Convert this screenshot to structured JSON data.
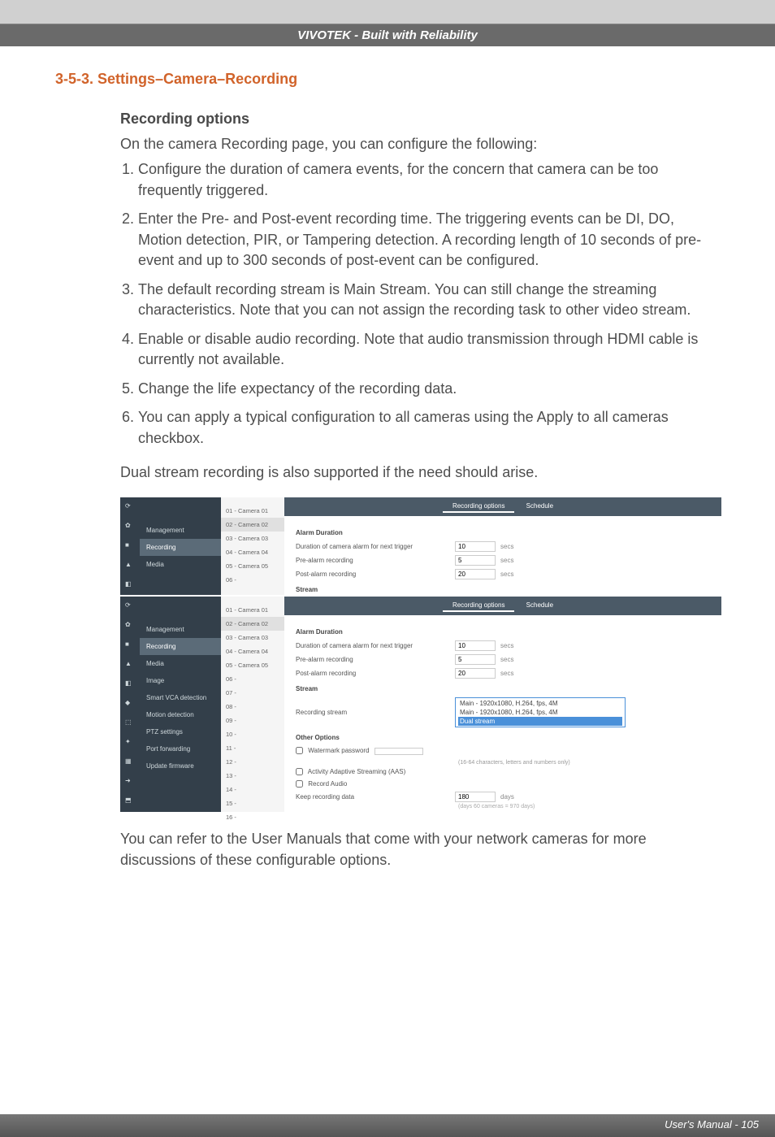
{
  "header": "VIVOTEK - Built with Reliability",
  "section_title": "3-5-3. Settings–Camera–Recording",
  "subsection_title": "Recording options",
  "intro": "On the camera Recording page, you can configure the following:",
  "items": [
    "Configure the duration of camera events, for the concern that camera can be too frequently triggered.",
    "Enter the Pre- and Post-event recording time. The triggering events can be DI, DO, Motion detection, PIR, or Tampering detection. A recording length of 10 seconds of pre-event and up to 300 seconds of post-event can be configured.",
    "The default recording stream is Main Stream. You can still change the streaming characteristics. Note that you can not assign the recording task to other video stream.",
    "Enable or disable audio recording. Note that audio transmission through HDMI cable is currently not available.",
    "Change the life expectancy of the recording data.",
    "You can apply a typical configuration to all cameras using the Apply to all cameras checkbox."
  ],
  "dual_stream_note": "Dual stream recording is also supported if the need should arise.",
  "screenshot": {
    "tabs": {
      "recording_options": "Recording options",
      "schedule": "Schedule"
    },
    "nav_top": [
      "Management",
      "Recording",
      "Media"
    ],
    "nav_bot": [
      "Management",
      "Recording",
      "Media",
      "Image",
      "Smart VCA detection",
      "Motion detection",
      "PTZ settings",
      "Port forwarding",
      "Update firmware"
    ],
    "cameras_top": [
      "01 - Camera 01",
      "02 - Camera 02",
      "03 - Camera 03",
      "04 - Camera 04",
      "05 - Camera 05",
      "06 -"
    ],
    "cameras_bot": [
      "01 - Camera 01",
      "02 - Camera 02",
      "03 - Camera 03",
      "04 - Camera 04",
      "05 - Camera 05",
      "06 -",
      "07 -",
      "08 -",
      "09 -",
      "10 -",
      "11 -",
      "12 -",
      "13 -",
      "14 -",
      "15 -",
      "16 -"
    ],
    "panel": {
      "alarm_duration": "Alarm Duration",
      "dur_label": "Duration of camera alarm for next trigger",
      "dur_val": "10",
      "pre_label": "Pre-alarm recording",
      "pre_val": "5",
      "post_label": "Post-alarm recording",
      "post_val": "20",
      "secs": "secs",
      "stream_h": "Stream",
      "rec_stream_label": "Recording stream",
      "rec_stream_value": "Main - 1920x1080, H.264, fps, 4M",
      "dropdown_opts": [
        "Main - 1920x1080, H.264, fps, 4M",
        "Main - 1920x1080, H.264, fps, 4M",
        "Dual stream"
      ],
      "other_h": "Other Options",
      "watermark": "Watermark password",
      "watermark_hint": "(16-64 characters, letters and numbers only)",
      "aas": "Activity Adaptive Streaming (AAS)",
      "rec_audio": "Record Audio",
      "keep_label": "Keep recording data",
      "keep_val": "180",
      "days": "days",
      "keep_hint": "(days 60 cameras = 970 days)"
    }
  },
  "post_screenshot": "You can refer to the User Manuals that come with your network cameras for more discussions of these configurable options.",
  "footer": "User's Manual - 105"
}
